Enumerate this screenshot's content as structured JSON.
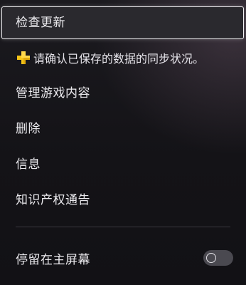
{
  "menu": {
    "check_update": "检查更新",
    "notice": {
      "icon": "ps-plus-icon",
      "icon_color": "#f5c518",
      "text": "请确认已保存的数据的同步状况。"
    },
    "manage_content": "管理游戏内容",
    "delete": "删除",
    "info": "信息",
    "ip_notice": "知识产权通告",
    "stay_home": {
      "label": "停留在主屏幕",
      "toggle_state": "off"
    }
  }
}
